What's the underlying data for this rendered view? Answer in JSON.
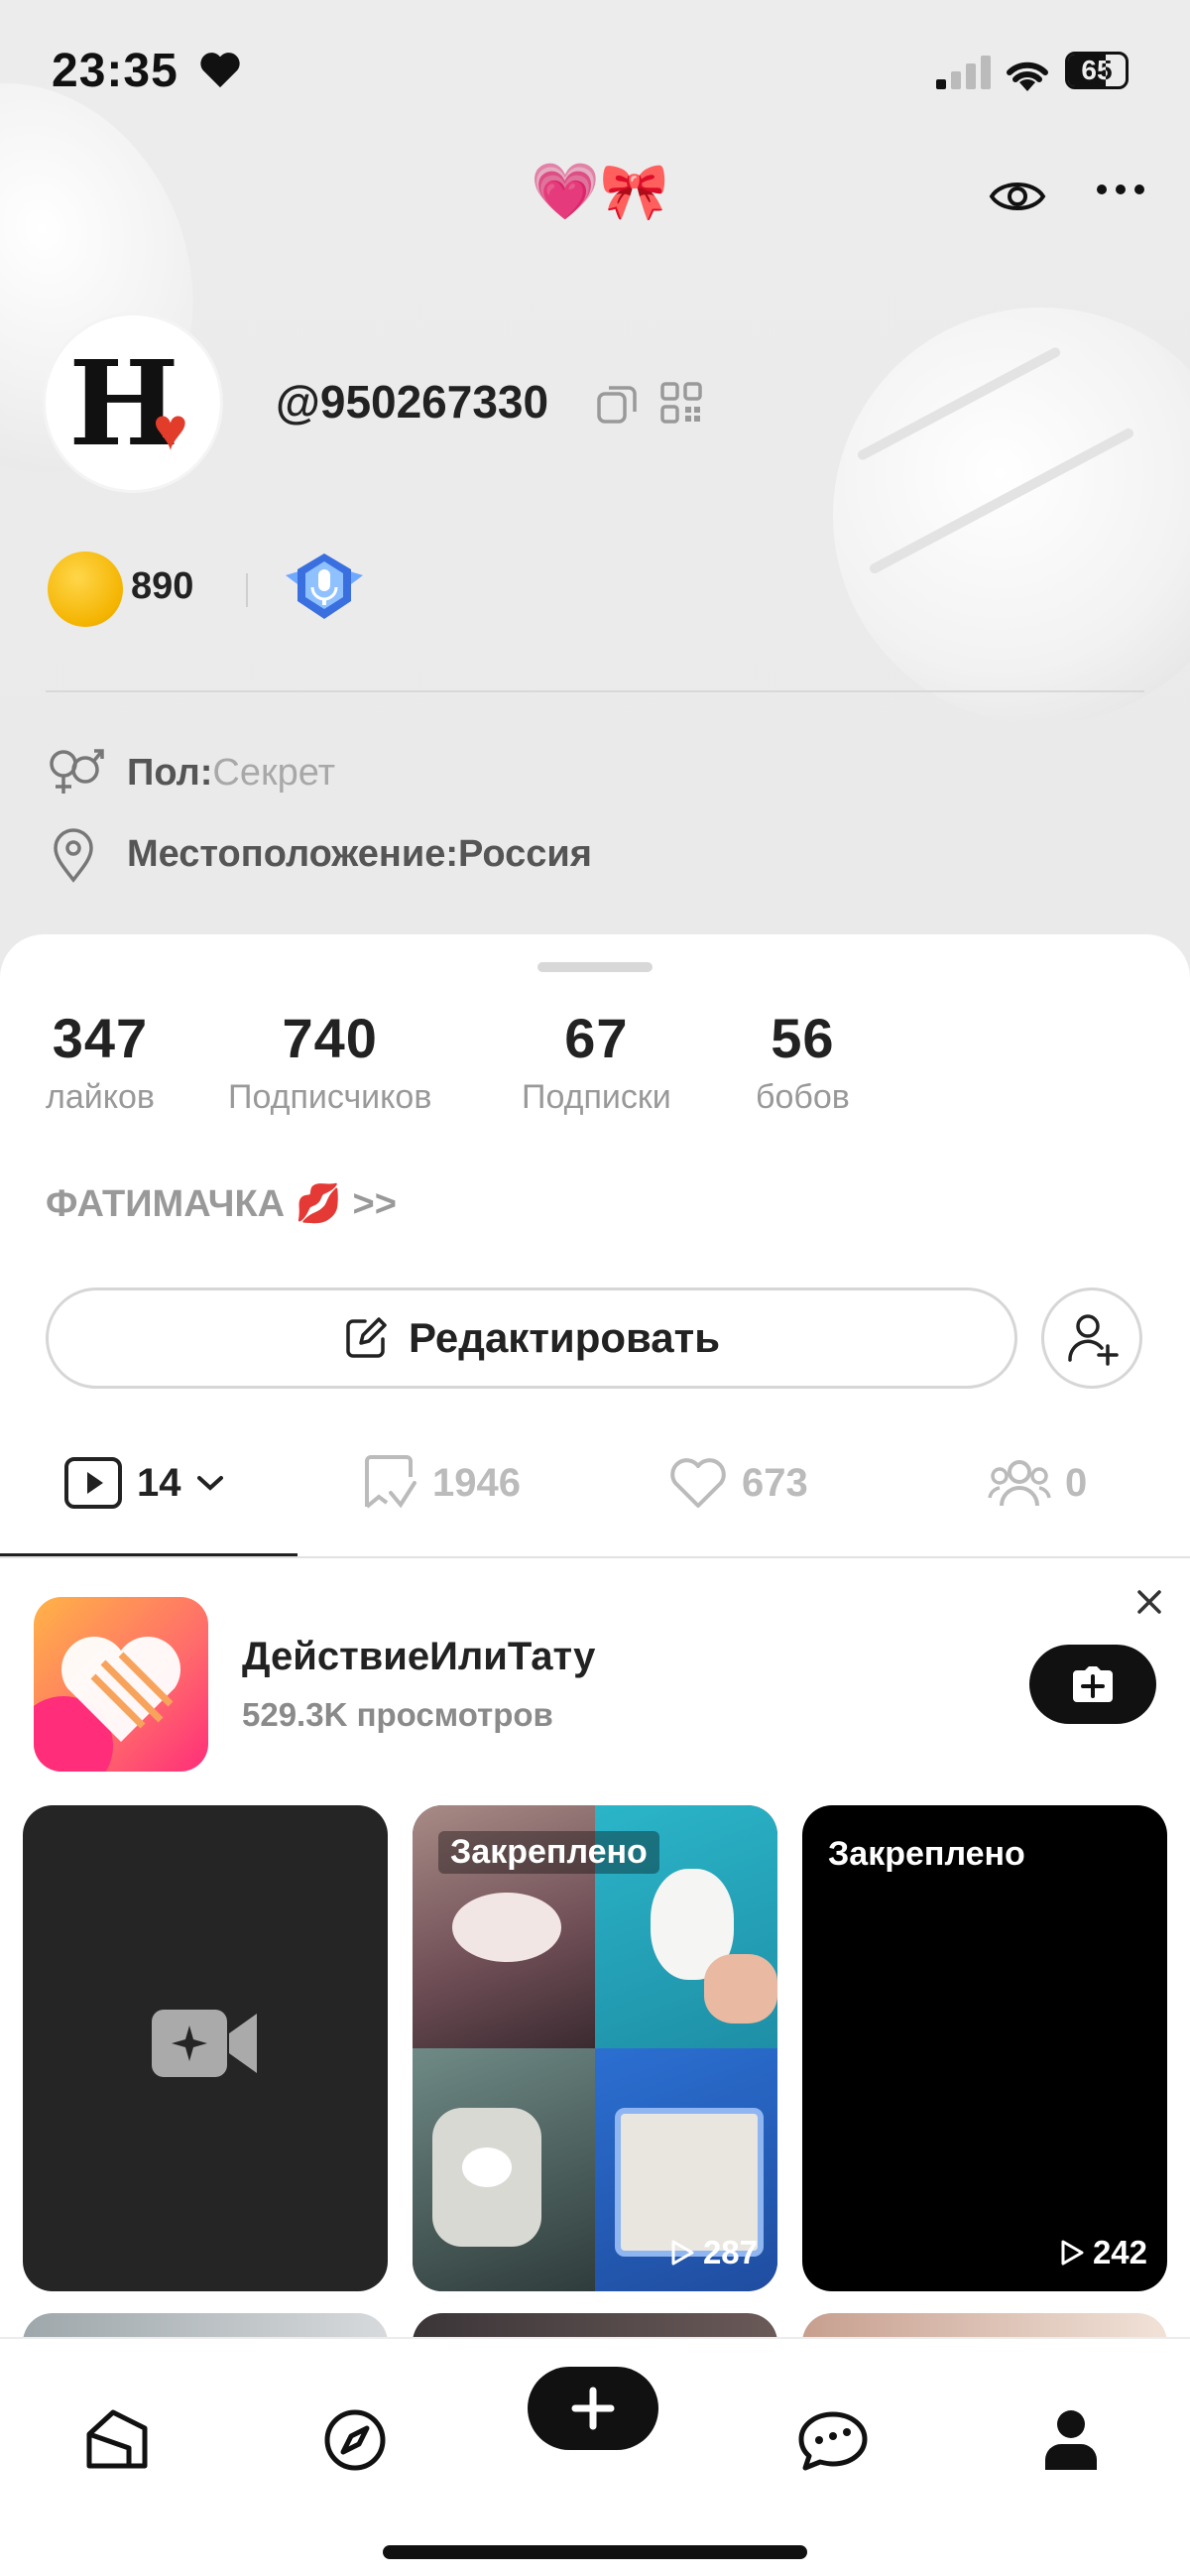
{
  "status_bar": {
    "time": "23:35",
    "battery": "65",
    "battery_level": 0.65
  },
  "header": {
    "title_emoji": "💗🎀",
    "username": "@950267330",
    "coins": "890",
    "gender_label": "Пол:",
    "gender_value": "Секрет",
    "location_label": "Местоположение:",
    "location_value": "Россия"
  },
  "stats": [
    {
      "value": "347",
      "label": "лайков"
    },
    {
      "value": "740",
      "label": "Подписчиков"
    },
    {
      "value": "67",
      "label": "Подписки"
    },
    {
      "value": "56",
      "label": "бобов"
    }
  ],
  "bio": "ФАТИМАЧКА 💋 >>",
  "edit_button": "Редактировать",
  "tabs": [
    {
      "icon": "play-box-icon",
      "count": "14"
    },
    {
      "icon": "repost-icon",
      "count": "1946"
    },
    {
      "icon": "heart-icon",
      "count": "673"
    },
    {
      "icon": "group-icon",
      "count": "0"
    }
  ],
  "promo": {
    "title": "ДействиеИлиТату",
    "views": "529.3K просмотров"
  },
  "videos": [
    {
      "type": "create",
      "pin_label": "",
      "views": ""
    },
    {
      "type": "video",
      "pin_label": "Закреплено",
      "views": "287"
    },
    {
      "type": "video",
      "pin_label": "Закреплено",
      "views": "242"
    }
  ],
  "colors": {
    "accent": "#111111",
    "header_bg": "#ececec",
    "muted_text": "#999999",
    "heart": "#e23c2a",
    "coin": "#f4b400"
  },
  "bottom_nav": [
    "home-icon",
    "compass-icon",
    "plus-icon",
    "chat-icon",
    "profile-icon"
  ]
}
